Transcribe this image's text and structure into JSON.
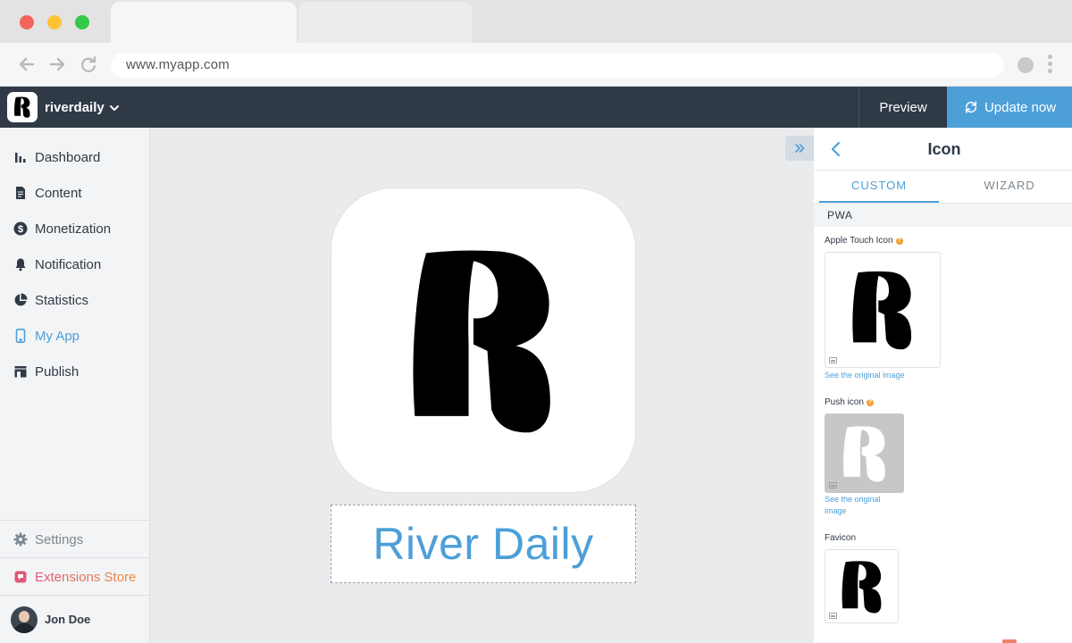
{
  "browser": {
    "url": "www.myapp.com"
  },
  "appbar": {
    "app_name": "riverdaily",
    "preview_label": "Preview",
    "update_label": "Update now"
  },
  "sidebar": {
    "items": [
      {
        "label": "Dashboard",
        "icon": "bar-chart-icon"
      },
      {
        "label": "Content",
        "icon": "document-icon"
      },
      {
        "label": "Monetization",
        "icon": "dollar-icon"
      },
      {
        "label": "Notification",
        "icon": "bell-icon"
      },
      {
        "label": "Statistics",
        "icon": "pie-chart-icon"
      },
      {
        "label": "My App",
        "icon": "phone-icon",
        "active": true
      },
      {
        "label": "Publish",
        "icon": "store-icon"
      }
    ],
    "settings_label": "Settings",
    "extensions_label": "Extensions Store",
    "user_name": "Jon Doe"
  },
  "canvas": {
    "app_display_name": "River Daily"
  },
  "panel": {
    "title": "Icon",
    "tabs": [
      {
        "label": "CUSTOM",
        "active": true
      },
      {
        "label": "WIZARD",
        "active": false
      }
    ],
    "section": "PWA",
    "fields": [
      {
        "label": "Apple Touch Icon",
        "link": "See the original image"
      },
      {
        "label": "Push icon",
        "link_line1": "See the original",
        "link_line2": "image"
      },
      {
        "label": "Favicon"
      }
    ]
  },
  "colors": {
    "accent": "#4d9fd8",
    "topbar": "#2f3a46",
    "sidebar_bg": "#f3f4f5",
    "canvas_bg": "#e9ebed"
  }
}
